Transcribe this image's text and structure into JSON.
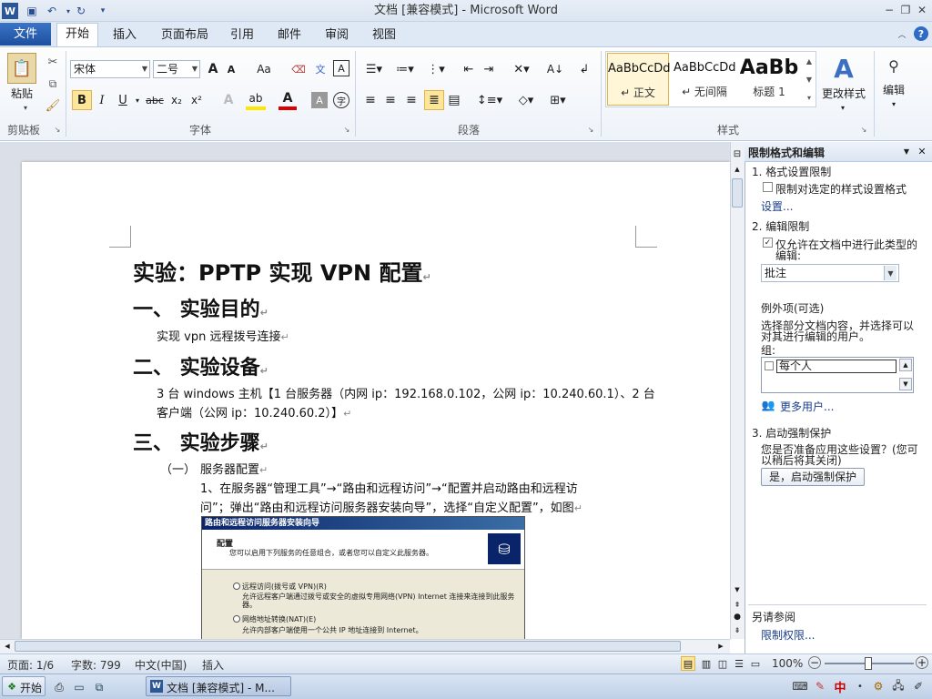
{
  "window": {
    "title": "文档 [兼容模式]  -  Microsoft Word"
  },
  "tabs": {
    "file": "文件",
    "home": "开始",
    "insert": "插入",
    "layout": "页面布局",
    "references": "引用",
    "mailings": "邮件",
    "review": "审阅",
    "view": "视图"
  },
  "ribbon": {
    "clipboard": {
      "label": "剪贴板",
      "paste": "粘贴"
    },
    "font": {
      "label": "字体",
      "name": "宋体",
      "size": "二号",
      "bold": "B",
      "italic": "I",
      "underline": "U",
      "strike": "abc",
      "sub": "x₂",
      "sup": "x²",
      "grow": "A",
      "shrink": "A",
      "case": "Aa"
    },
    "paragraph": {
      "label": "段落"
    },
    "styles": {
      "label": "样式",
      "items": [
        {
          "sample": "AaBbCcDd",
          "name": "↵ 正文"
        },
        {
          "sample": "AaBbCcDd",
          "name": "↵ 无间隔"
        },
        {
          "sample": "AaBb",
          "name": "标题 1"
        }
      ],
      "change": "更改样式"
    },
    "editing": {
      "label": "编辑"
    }
  },
  "document": {
    "title": "实验：PPTP 实现 VPN 配置",
    "h_purpose": "一、 实验目的",
    "purpose": "实现 vpn 远程拨号连接",
    "h_equipment": "二、 实验设备",
    "equipment_1": "3 台 windows 主机【1 台服务器（内网 ip：192.168.0.102，公网 ip：10.240.60.1）、2 台",
    "equipment_2": "客户端（公网 ip：10.240.60.2）】",
    "h_steps": "三、 实验步骤",
    "sub1_num": "（一）",
    "sub1": "服务器配置",
    "step1_1": "1、在服务器“管理工具”→“路由和远程访问”→“配置并启动路由和远程访",
    "step1_2": "问”；弹出“路由和远程访问服务器安装向导”，选择“自定义配置”，如图",
    "para_mark": "↵"
  },
  "dialog": {
    "title": "路由和远程访问服务器安装向导",
    "heading": "配置",
    "desc": "您可以启用下列服务的任意组合，或者您可以自定义此服务器。",
    "opt1": "远程访问(拨号或 VPN)(R)",
    "opt1_desc": "允许远程客户端通过拨号或安全的虚拟专用网络(VPN) Internet 连接来连接到此服务器。",
    "opt2": "网络地址转换(NAT)(E)",
    "opt2_desc": "允许内部客户端使用一个公共 IP 地址连接到 Internet。"
  },
  "pane": {
    "title": "限制格式和编辑",
    "s1": "1. 格式设置限制",
    "s1_check": "限制对选定的样式设置格式",
    "s1_link": "设置...",
    "s2": "2. 编辑限制",
    "s2_check1": "仅允许在文档中进行此类型的",
    "s2_check2": "编辑:",
    "s2_select": "批注",
    "exceptions": "例外项(可选)",
    "exceptions_desc1": "选择部分文档内容，并选择可以",
    "exceptions_desc2": "对其进行编辑的用户。",
    "group": "组:",
    "everyone": "每个人",
    "more_users": "更多用户...",
    "s3": "3. 启动强制保护",
    "s3_desc1": "您是否准备应用这些设置？(您可",
    "s3_desc2": "以稍后将其关闭)",
    "s3_button": "是，启动强制保护",
    "see_also": "另请参阅",
    "permissions": "限制权限..."
  },
  "status": {
    "page": "页面: 1/6",
    "words": "字数: 799",
    "lang": "中文(中国)",
    "mode": "插入",
    "zoom": "100%"
  },
  "taskbar": {
    "start": "开始",
    "task": "文档 [兼容模式] - M...",
    "ime": "中"
  }
}
